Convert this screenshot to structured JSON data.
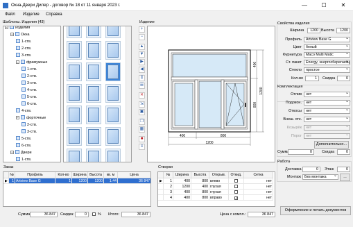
{
  "window": {
    "title": "Окна-Двери Дилер - договор № 18 от 11 января 2023 г.",
    "min_glyph": "—",
    "max_glyph": "☐",
    "close_glyph": "✕"
  },
  "menu": [
    "Файл",
    "Изделие",
    "Справка"
  ],
  "templates": {
    "header": "Шаблоны. Изделия (43)",
    "tree": [
      {
        "label": "Изделия",
        "level": 0,
        "toggle": "−"
      },
      {
        "label": "Окна",
        "level": 1,
        "toggle": "−"
      },
      {
        "label": "1-ств.",
        "level": 2,
        "toggle": ""
      },
      {
        "label": "2-ств.",
        "level": 2,
        "toggle": ""
      },
      {
        "label": "3-ств.",
        "level": 2,
        "toggle": ""
      },
      {
        "label": "фрамужные",
        "level": 2,
        "toggle": "−"
      },
      {
        "label": "1-ств.",
        "level": 3,
        "toggle": ""
      },
      {
        "label": "2-ств.",
        "level": 3,
        "toggle": ""
      },
      {
        "label": "3-ств.",
        "level": 3,
        "toggle": ""
      },
      {
        "label": "4-ств.",
        "level": 3,
        "toggle": ""
      },
      {
        "label": "5-ств.",
        "level": 3,
        "toggle": ""
      },
      {
        "label": "6-ств.",
        "level": 3,
        "toggle": ""
      },
      {
        "label": "4-ств.",
        "level": 2,
        "toggle": ""
      },
      {
        "label": "форточные",
        "level": 2,
        "toggle": "−"
      },
      {
        "label": "2-ств.",
        "level": 3,
        "toggle": ""
      },
      {
        "label": "3-ств.",
        "level": 3,
        "toggle": ""
      },
      {
        "label": "5-ств.",
        "level": 2,
        "toggle": ""
      },
      {
        "label": "6-ств.",
        "level": 2,
        "toggle": ""
      },
      {
        "label": "Двери",
        "level": 1,
        "toggle": "−"
      },
      {
        "label": "1-ств.",
        "level": 2,
        "toggle": ""
      },
      {
        "label": "2-ств.",
        "level": 2,
        "toggle": ""
      }
    ]
  },
  "product_header": "Изделие",
  "drawing": {
    "dim_top": [
      "400",
      "800"
    ],
    "dim_top_total": "1200",
    "dim_right": [
      "400",
      "800"
    ],
    "dim_right_total": "1200"
  },
  "props": {
    "header": "Свойства изделия",
    "width_label": "Ширина",
    "width": "1200",
    "height_label": "Высота",
    "height": "1200",
    "rows": [
      {
        "label": "Профиль",
        "value": "Artview Base G"
      },
      {
        "label": "Цвет",
        "value": "белый"
      },
      {
        "label": "Фурнитура",
        "value": "Maco Multi Matic"
      },
      {
        "label": "Ст. пакет",
        "value": "Energy, энергосберегающее"
      },
      {
        "label": "Стекло",
        "value": "простое"
      }
    ],
    "qty_label": "Кол-во",
    "qty": "1",
    "discount_label": "Скидка",
    "discount": "0"
  },
  "kit": {
    "header": "Комплектация",
    "rows": [
      {
        "label": "Отлив",
        "value": "нет"
      },
      {
        "label": "Подокон.",
        "value": "нет"
      },
      {
        "label": "Откосы",
        "value": "нет"
      },
      {
        "label": "Внеш. отк.",
        "value": "нет"
      },
      {
        "label": "Козырёк",
        "value": "нет"
      },
      {
        "label": "Порог",
        "value": "нет"
      }
    ],
    "extra_button": "Дополнительно...",
    "sum_label": "Сумма",
    "sum": "0",
    "discount_label": "Скидка",
    "discount": "0"
  },
  "work": {
    "header": "Работа",
    "delivery_label": "Доставка",
    "delivery": "0",
    "floor_label": "Этаж",
    "floor": "0",
    "mount_label": "Монтаж",
    "mount": "Без монтажа",
    "mount_button": "..."
  },
  "order": {
    "header": "Заказ",
    "columns": [
      "№",
      "Профиль",
      "Кол-во",
      "Ширина",
      "Высота",
      "кв. м",
      "Цена"
    ],
    "rows": [
      {
        "no": "1",
        "profile": "Artview Base G",
        "qty": "1",
        "width": "1200",
        "height": "1200",
        "sqm": "1.44",
        "price": "36 847"
      }
    ],
    "sum_label": "Сумма:",
    "sum": "36 847",
    "discount_label": "Скидка:",
    "discount": "0",
    "percent_label": "%",
    "total_label": "Итого:",
    "total": "36 847"
  },
  "sashes": {
    "header": "Створки",
    "columns": [
      "№",
      "Ширина",
      "Высота",
      "Открыв.",
      "Откид.",
      "Сетка"
    ],
    "rows": [
      {
        "no": "1",
        "width": "400",
        "height": "800",
        "open": "влево",
        "tilt": false,
        "net": "нет"
      },
      {
        "no": "2",
        "width": "1200",
        "height": "400",
        "open": "глухая",
        "tilt": false,
        "net": "нет"
      },
      {
        "no": "3",
        "width": "400",
        "height": "800",
        "open": "глухая",
        "tilt": false,
        "net": "нет"
      },
      {
        "no": "4",
        "width": "400",
        "height": "800",
        "open": "вправо",
        "tilt": true,
        "net": "нет"
      }
    ],
    "kit_price_label": "Цена с компл.:",
    "kit_price": "36 847"
  },
  "print_button": "Оформление и печать документов"
}
